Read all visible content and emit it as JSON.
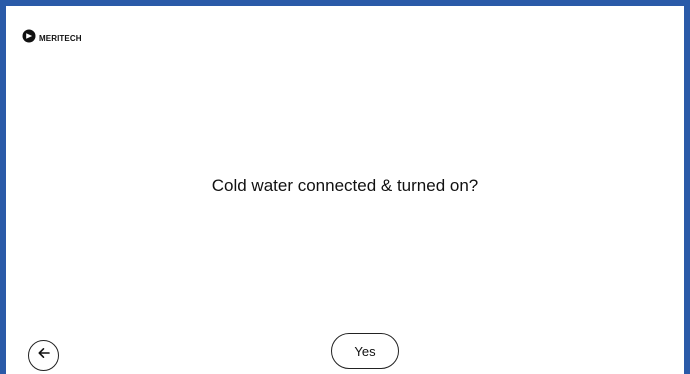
{
  "brand": {
    "name": "MERITECH",
    "logo_icon": "meritech-logo-icon"
  },
  "prompt": {
    "question": "Cold water connected & turned on?"
  },
  "actions": {
    "yes_label": "Yes",
    "back_icon": "arrow-left-icon"
  },
  "colors": {
    "frame": "#2a5aa8",
    "background": "#ffffff",
    "text": "#111111"
  }
}
